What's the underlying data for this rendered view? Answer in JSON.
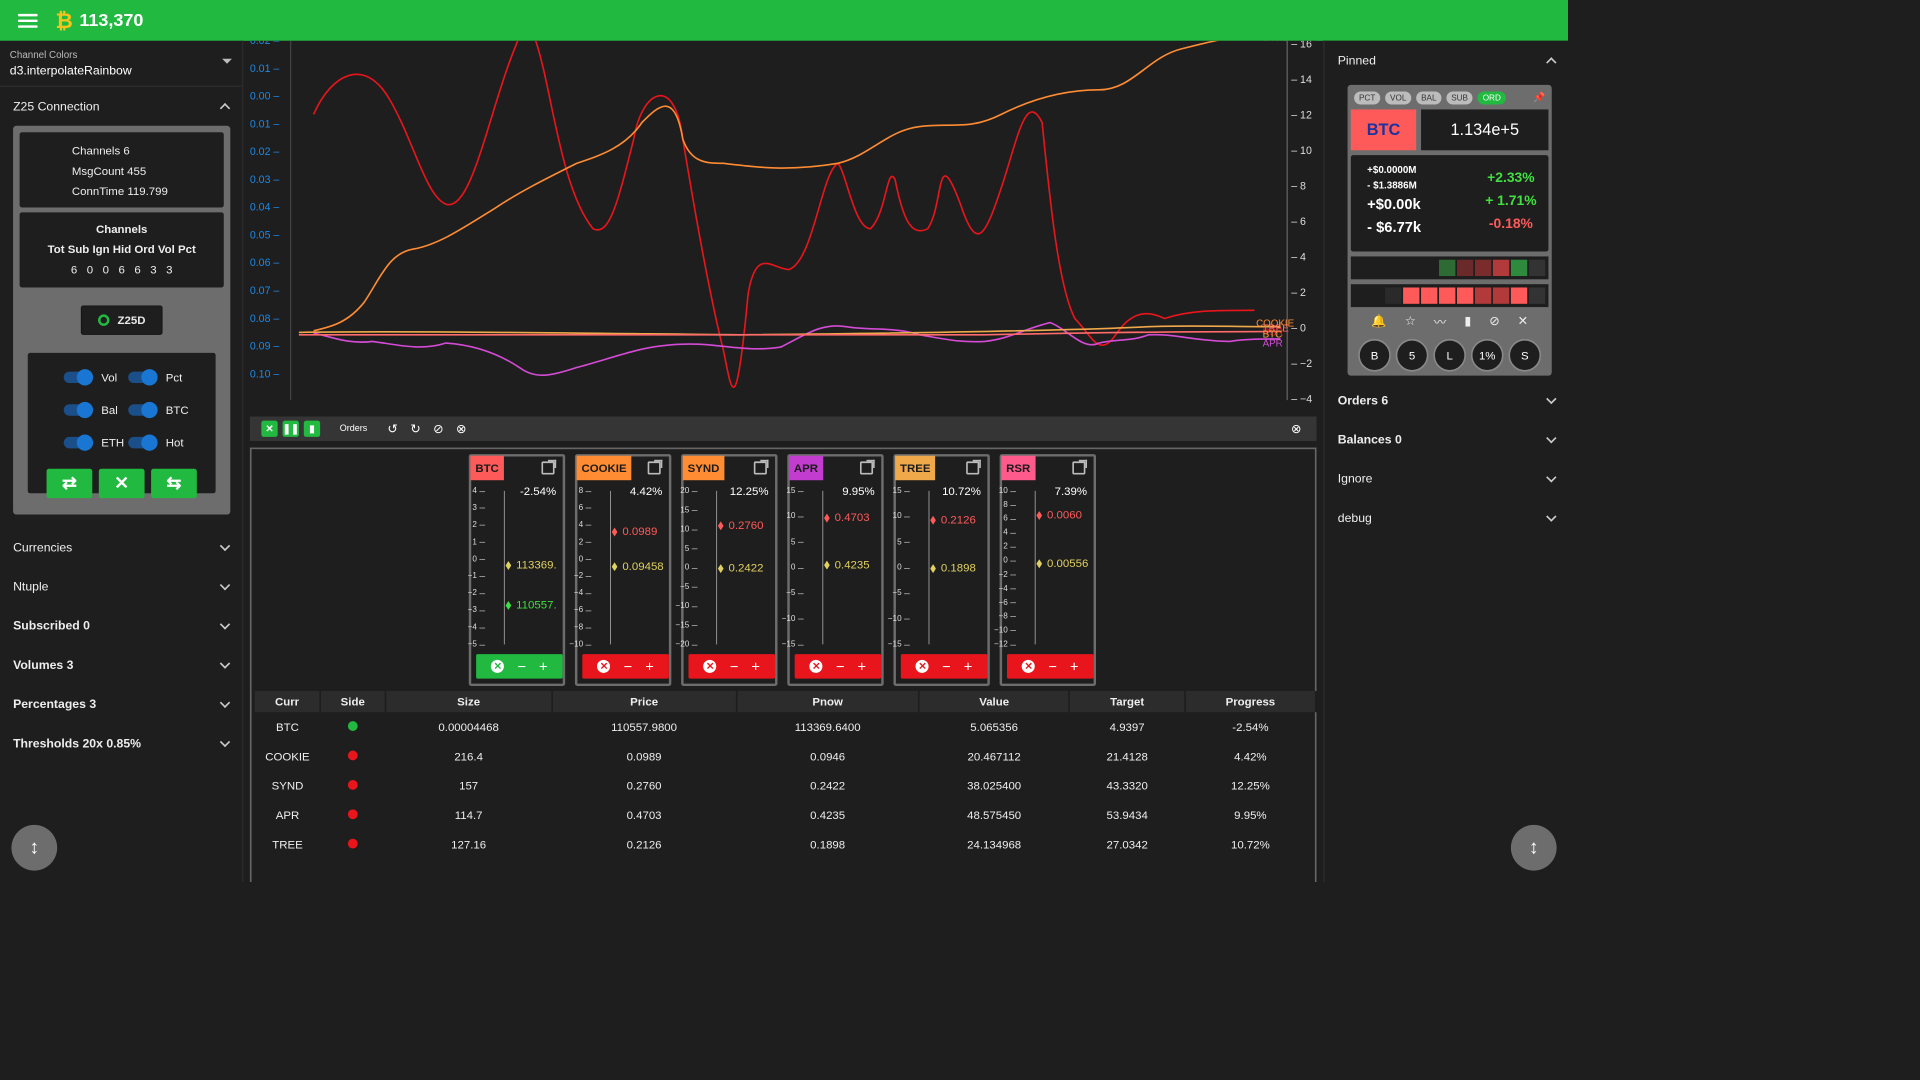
{
  "topbar": {
    "btc_symbol": "₿",
    "btc_price": "113,370"
  },
  "left": {
    "channel_colors_label": "Channel Colors",
    "channel_colors_value": "d3.interpolateRainbow",
    "z25_title": "Z25 Connection",
    "info": {
      "channels": "Channels  6",
      "msgcount": "MsgCount 455",
      "conntime": "ConnTime 119.799"
    },
    "channels_title": "Channels",
    "channels_header": "Tot Sub Ign Hid Ord Vol Pct",
    "channels_values": "6   0   0   6   6   3   3",
    "z25d_label": "Z25D",
    "toggles": [
      "Vol",
      "Pct",
      "Bal",
      "BTC",
      "ETH",
      "Hot"
    ],
    "buttons": [
      "⇄",
      "✕",
      "⇆"
    ],
    "sections": [
      "Currencies",
      "Ntuple",
      "Subscribed 0",
      "Volumes 3",
      "Percentages 3",
      "Thresholds 20x 0.85%"
    ]
  },
  "chart_data": {
    "type": "line",
    "left_axis_ticks": [
      "0.02",
      "0.01",
      "0.00",
      "0.01",
      "0.02",
      "0.03",
      "0.04",
      "0.05",
      "0.06",
      "0.07",
      "0.08",
      "0.09",
      "0.10"
    ],
    "right_axis_ticks": [
      "16",
      "14",
      "12",
      "10",
      "8",
      "6",
      "4",
      "2",
      "0",
      "−2",
      "−4"
    ],
    "series_labels": [
      "SYND",
      "COOKIE",
      "TREE",
      "RSR",
      "BTC",
      "APR"
    ],
    "colors": {
      "red": "#e8151c",
      "orange": "#ff8c33",
      "magenta": "#d44bd6",
      "gold": "#f0a94a"
    }
  },
  "controls": {
    "orders_label": "Orders"
  },
  "cards": [
    {
      "sym": "BTC",
      "color": "#ff5a5a",
      "pct": "-2.54%",
      "ticks": [
        "4",
        "3",
        "2",
        "1",
        "0",
        "−1",
        "−2",
        "−3",
        "−4",
        "−5"
      ],
      "m1": "113369.",
      "m1c": "#e0d060",
      "m1v": 0,
      "m2": "110557.",
      "m2c": "#40e040",
      "m2v": -2.5,
      "min": -5,
      "max": 4.6,
      "btn": "green"
    },
    {
      "sym": "COOKIE",
      "color": "#ff8c33",
      "pct": "4.42%",
      "ticks": [
        "8",
        "6",
        "4",
        "2",
        "0",
        "−2",
        "−4",
        "−6",
        "−8",
        "−10"
      ],
      "m1": "0.0989",
      "m1c": "#ff5a5a",
      "m1v": 4.4,
      "m2": "0.09458",
      "m2c": "#e0d060",
      "m2v": 0,
      "min": -10,
      "max": 9.5,
      "btn": "red"
    },
    {
      "sym": "SYND",
      "color": "#ff8c33",
      "pct": "12.25%",
      "ticks": [
        "20",
        "15",
        "10",
        "5",
        "0",
        "−5",
        "−10",
        "−15",
        "−20"
      ],
      "m1": "0.2760",
      "m1c": "#ff5a5a",
      "m1v": 12.25,
      "m2": "0.2422",
      "m2c": "#e0d060",
      "m2v": 0,
      "min": -22,
      "max": 22,
      "btn": "red"
    },
    {
      "sym": "APR",
      "color": "#c23ccf",
      "pct": "9.95%",
      "ticks": [
        "15",
        "10",
        "5",
        "0",
        "−5",
        "−10",
        "−15"
      ],
      "m1": "0.4703",
      "m1c": "#ff5a5a",
      "m1v": 9.95,
      "m2": "0.4235",
      "m2c": "#e0d060",
      "m2v": 0,
      "min": -17,
      "max": 15.5,
      "btn": "red"
    },
    {
      "sym": "TREE",
      "color": "#f0a94a",
      "pct": "10.72%",
      "ticks": [
        "15",
        "10",
        "5",
        "0",
        "−5",
        "−10",
        "−15"
      ],
      "m1": "0.2126",
      "m1c": "#ff5a5a",
      "m1v": 10.72,
      "m2": "0.1898",
      "m2c": "#e0d060",
      "m2v": 0,
      "min": -17,
      "max": 17,
      "btn": "red"
    },
    {
      "sym": "RSR",
      "color": "#ff5a8c",
      "pct": "7.39%",
      "ticks": [
        "10",
        "8",
        "6",
        "4",
        "2",
        "0",
        "−2",
        "−4",
        "−6",
        "−8",
        "−10",
        "−12"
      ],
      "m1": "0.0060",
      "m1c": "#ff5a5a",
      "m1v": 7.39,
      "m2": "0.00556",
      "m2c": "#e0d060",
      "m2v": 0,
      "min": -12.5,
      "max": 11,
      "btn": "red"
    }
  ],
  "table": {
    "headers": [
      "Curr",
      "Side",
      "Size",
      "Price",
      "Pnow",
      "Value",
      "Target",
      "Progress"
    ],
    "rows": [
      {
        "curr": "BTC",
        "side": "green",
        "size": "0.00004468",
        "price": "110557.9800",
        "pnow": "113369.6400",
        "value": "5.065356",
        "target": "4.9397",
        "progress": "-2.54%"
      },
      {
        "curr": "COOKIE",
        "side": "red",
        "size": "216.4",
        "price": "0.0989",
        "pnow": "0.0946",
        "value": "20.467112",
        "target": "21.4128",
        "progress": "4.42%"
      },
      {
        "curr": "SYND",
        "side": "red",
        "size": "157",
        "price": "0.2760",
        "pnow": "0.2422",
        "value": "38.025400",
        "target": "43.3320",
        "progress": "12.25%"
      },
      {
        "curr": "APR",
        "side": "red",
        "size": "114.7",
        "price": "0.4703",
        "pnow": "0.4235",
        "value": "48.575450",
        "target": "53.9434",
        "progress": "9.95%"
      },
      {
        "curr": "TREE",
        "side": "red",
        "size": "127.16",
        "price": "0.2126",
        "pnow": "0.1898",
        "value": "24.134968",
        "target": "27.0342",
        "progress": "10.72%"
      }
    ]
  },
  "right": {
    "pinned_title": "Pinned",
    "pills": [
      "PCT",
      "VOL",
      "BAL",
      "SUB",
      "ORD"
    ],
    "btc_label": "BTC",
    "btc_value": "1.134e+5",
    "stats_left": [
      "+$0.0000M",
      "- $1.3886M",
      "+$0.00k",
      "- $6.77k"
    ],
    "stats_right": [
      "+2.33%",
      "+ 1.71%",
      "-0.18%"
    ],
    "circle_buttons": [
      "B",
      "5",
      "L",
      "1%",
      "S"
    ],
    "sections": [
      "Orders 6",
      "Balances 0",
      "Ignore",
      "debug"
    ]
  }
}
